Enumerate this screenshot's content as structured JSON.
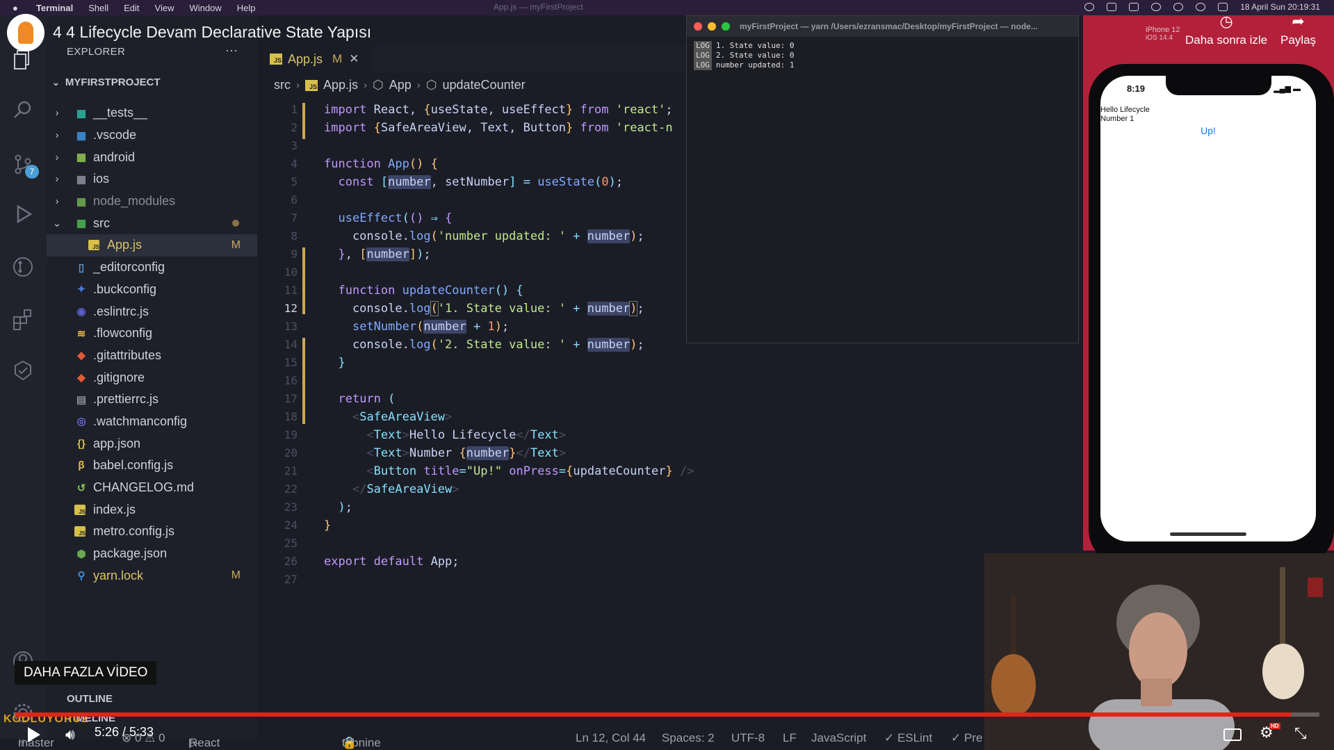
{
  "video": {
    "title": "4 4 Lifecycle Devam Declarative State Yapısı",
    "watch_later": "Daha sonra izle",
    "share": "Paylaş",
    "more_videos": "DAHA FAZLA VİDEO",
    "time": "5:26 / 5:33",
    "progress": 0.978,
    "watermark": "KODLUYORUZ",
    "accent": "#e62117"
  },
  "menubar": {
    "app": "Terminal",
    "items": [
      "Shell",
      "Edit",
      "View",
      "Window",
      "Help"
    ],
    "window_title": "App.js — myFirstProject",
    "clock": "18 April Sun  20:19:31"
  },
  "explorer": {
    "header": "EXPLORER",
    "more": "···",
    "project": "MYFIRSTPROJECT",
    "items": [
      {
        "label": "__tests__",
        "kind": "folder",
        "icon": "folder-test-icon"
      },
      {
        "label": ".vscode",
        "kind": "folder",
        "icon": "folder-vscode-icon"
      },
      {
        "label": "android",
        "kind": "folder",
        "icon": "folder-android-icon"
      },
      {
        "label": "ios",
        "kind": "folder",
        "icon": "folder-ios-icon"
      },
      {
        "label": "node_modules",
        "kind": "folder",
        "icon": "folder-node-icon"
      },
      {
        "label": "src",
        "kind": "folder-open",
        "icon": "folder-src-icon"
      },
      {
        "label": "App.js",
        "kind": "file-child",
        "icon": "js-file-icon",
        "mark": "M"
      },
      {
        "label": "_editorconfig",
        "kind": "file",
        "icon": "file-icon"
      },
      {
        "label": ".buckconfig",
        "kind": "file",
        "icon": "buck-icon"
      },
      {
        "label": ".eslintrc.js",
        "kind": "file",
        "icon": "eslint-icon"
      },
      {
        "label": ".flowconfig",
        "kind": "file",
        "icon": "flow-icon"
      },
      {
        "label": ".gitattributes",
        "kind": "file",
        "icon": "git-icon"
      },
      {
        "label": ".gitignore",
        "kind": "file",
        "icon": "git-icon"
      },
      {
        "label": ".prettierrc.js",
        "kind": "file",
        "icon": "prettier-icon"
      },
      {
        "label": ".watchmanconfig",
        "kind": "file",
        "icon": "watchman-icon"
      },
      {
        "label": "app.json",
        "kind": "file",
        "icon": "json-icon"
      },
      {
        "label": "babel.config.js",
        "kind": "file",
        "icon": "babel-icon"
      },
      {
        "label": "CHANGELOG.md",
        "kind": "file",
        "icon": "changelog-icon"
      },
      {
        "label": "index.js",
        "kind": "file",
        "icon": "js-file-icon"
      },
      {
        "label": "metro.config.js",
        "kind": "file",
        "icon": "js-file-icon"
      },
      {
        "label": "package.json",
        "kind": "file",
        "icon": "node-icon"
      },
      {
        "label": "yarn.lock",
        "kind": "file",
        "icon": "yarn-icon",
        "mark": "M"
      }
    ],
    "outline": "OUTLINE",
    "timeline": "TIMELINE"
  },
  "activity": {
    "scm_badge": "7"
  },
  "editor": {
    "tab": {
      "name": "App.js",
      "mark": "M",
      "close": "✕",
      "js": "JS"
    },
    "breadcrumb": [
      "src",
      "App.js",
      "App",
      "updateCounter"
    ],
    "current_line": 12
  },
  "terminal": {
    "title": "myFirstProject — yarn /Users/ezransmac/Desktop/myFirstProject — node...",
    "lines": [
      {
        "tag": "LOG",
        "text": "1. State value: 0"
      },
      {
        "tag": "LOG",
        "text": "2. State value: 0"
      },
      {
        "tag": "LOG",
        "text": "number updated: 1"
      }
    ]
  },
  "simulator": {
    "device": "iPhone 12",
    "os": "iOS 14.4",
    "time": "8:19",
    "text1": "Hello Lifecycle",
    "text2": "Number 1",
    "button": "Up!"
  },
  "statusbar": {
    "branch": "master",
    "problems": "⊗ 0 ⚠ 0",
    "packager": "React Native Packager",
    "tabnine": "tabnine",
    "position": "Ln 12, Col 44",
    "spaces": "Spaces: 2",
    "encoding": "UTF-8",
    "eol": "LF",
    "language": "JavaScript",
    "eslint": "✓ ESLint",
    "prettier": "✓ Pre"
  }
}
